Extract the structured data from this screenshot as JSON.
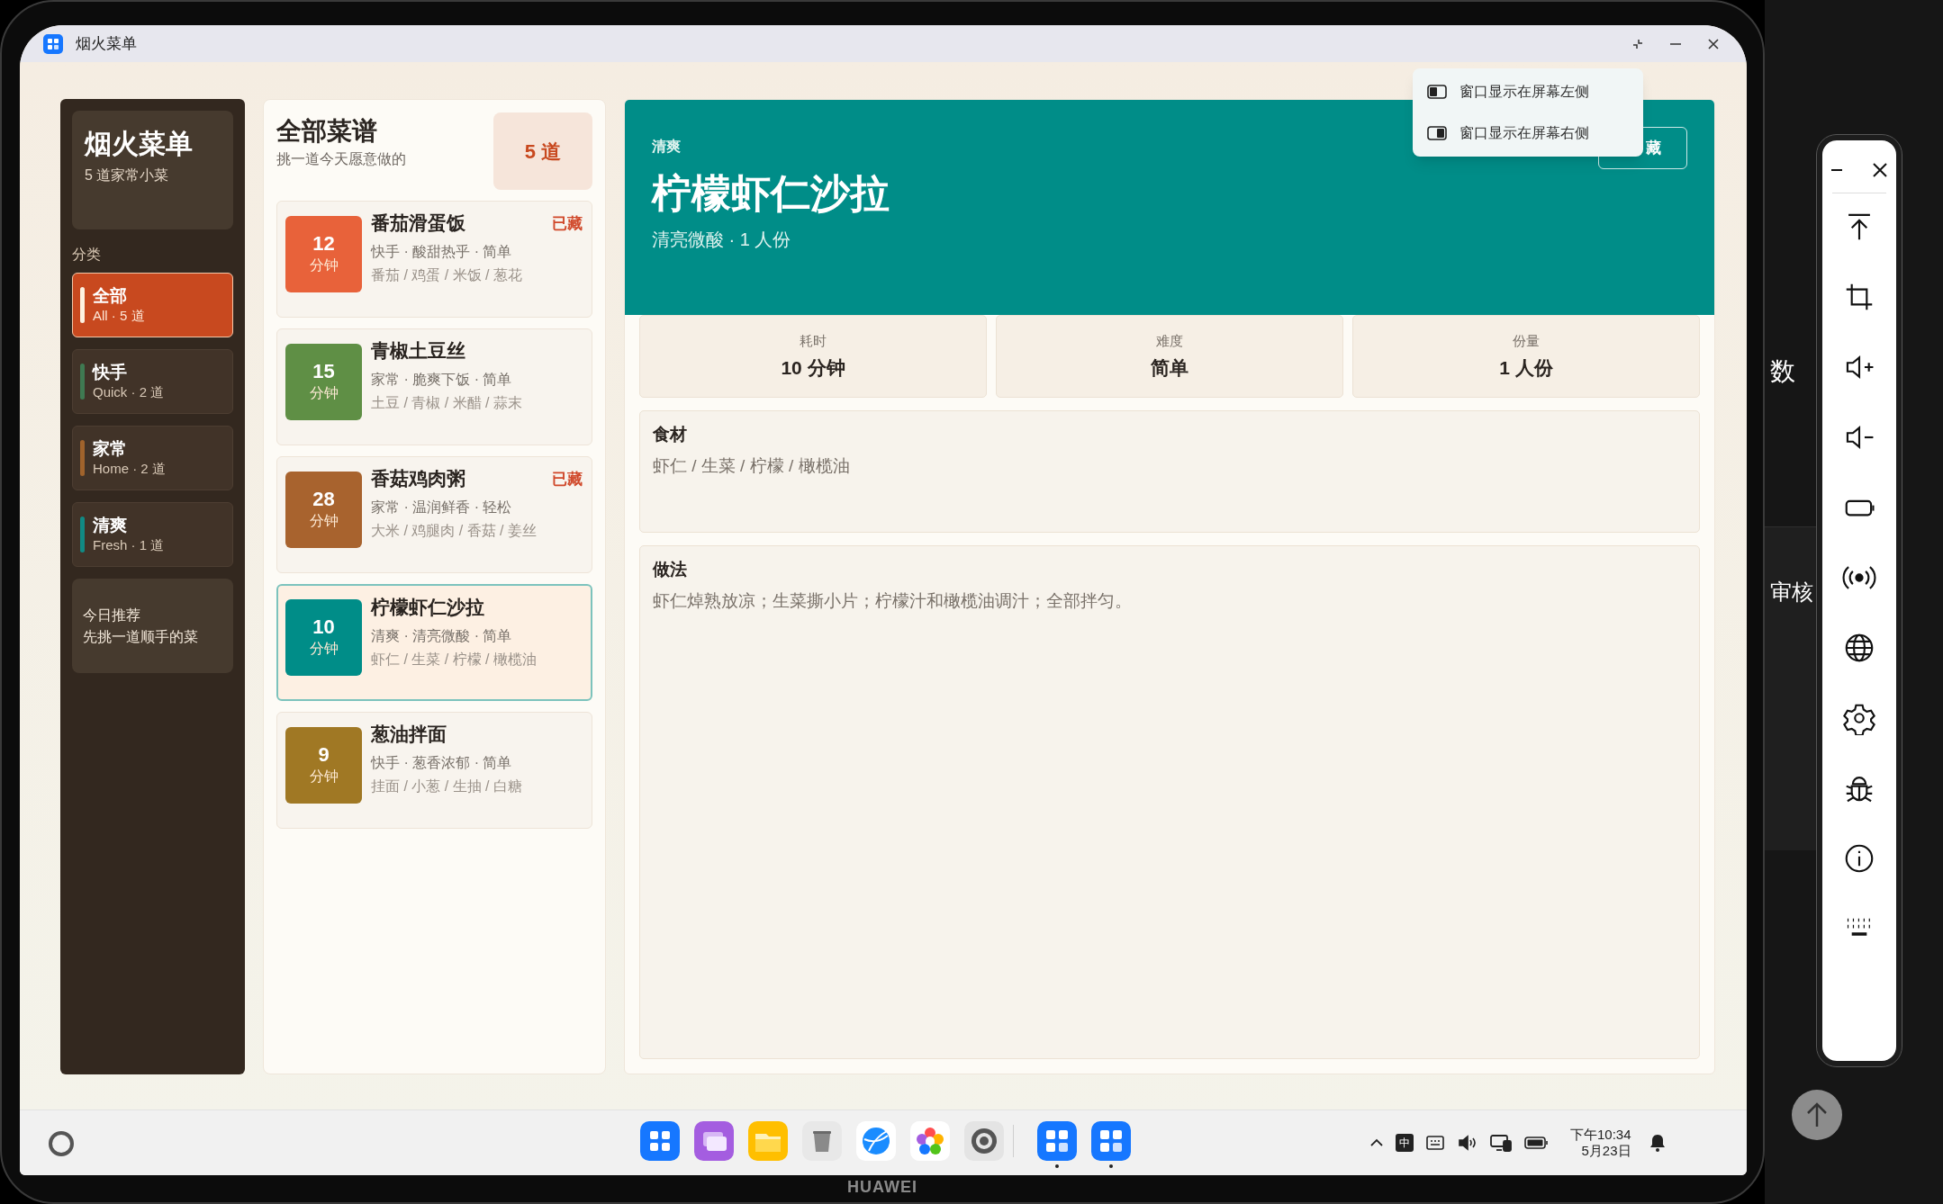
{
  "window": {
    "title": "烟火菜单"
  },
  "sidebar": {
    "title": "烟火菜单",
    "subtitle": "5 道家常小菜",
    "section_label": "分类",
    "categories": [
      {
        "name": "全部",
        "caption": "All · 5 道",
        "color": "#fdf1e0",
        "selected": true
      },
      {
        "name": "快手",
        "caption": "Quick · 2 道",
        "color": "#3f7a52",
        "selected": false
      },
      {
        "name": "家常",
        "caption": "Home · 2 道",
        "color": "#a0632c",
        "selected": false
      },
      {
        "name": "清爽",
        "caption": "Fresh · 1 道",
        "color": "#118a84",
        "selected": false
      }
    ],
    "promo": {
      "title": "今日推荐",
      "text": "先挑一道顺手的菜"
    }
  },
  "recipe_list": {
    "title": "全部菜谱",
    "subtitle": "挑一道今天愿意做的",
    "count": "5 道",
    "items": [
      {
        "minutes": "12",
        "unit": "分钟",
        "color": "#e8623a",
        "name": "番茄滑蛋饭",
        "meta": "快手 · 酸甜热乎 · 简单",
        "ingredients": "番茄 / 鸡蛋 / 米饭 / 葱花",
        "badge": "已藏",
        "selected": false
      },
      {
        "minutes": "15",
        "unit": "分钟",
        "color": "#5f8f45",
        "name": "青椒土豆丝",
        "meta": "家常 · 脆爽下饭 · 简单",
        "ingredients": "土豆 / 青椒 / 米醋 / 蒜末",
        "selected": false
      },
      {
        "minutes": "28",
        "unit": "分钟",
        "color": "#a8632e",
        "name": "香菇鸡肉粥",
        "meta": "家常 · 温润鲜香 · 轻松",
        "ingredients": "大米 / 鸡腿肉 / 香菇 / 姜丝",
        "badge": "已藏",
        "selected": false
      },
      {
        "minutes": "10",
        "unit": "分钟",
        "color": "#008d88",
        "name": "柠檬虾仁沙拉",
        "meta": "清爽 · 清亮微酸 · 简单",
        "ingredients": "虾仁 / 生菜 / 柠檬 / 橄榄油",
        "selected": true
      },
      {
        "minutes": "9",
        "unit": "分钟",
        "color": "#a07824",
        "name": "葱油拌面",
        "meta": "快手 · 葱香浓郁 · 简单",
        "ingredients": "挂面 / 小葱 / 生抽 / 白糖",
        "selected": false
      }
    ]
  },
  "detail": {
    "tag": "清爽",
    "title": "柠檬虾仁沙拉",
    "subtitle": "清亮微酸 · 1 人份",
    "button": "藏",
    "stats": [
      {
        "label": "耗时",
        "value": "10 分钟"
      },
      {
        "label": "难度",
        "value": "简单"
      },
      {
        "label": "份量",
        "value": "1 人份"
      }
    ],
    "sections": [
      {
        "title": "食材",
        "text": "虾仁 / 生菜 / 柠檬 / 橄榄油"
      },
      {
        "title": "做法",
        "text": "虾仁焯熟放凉；生菜撕小片；柠檬汁和橄榄油调汁；全部拌匀。"
      }
    ]
  },
  "window_menu": {
    "items": [
      {
        "label": "窗口显示在屏幕左侧",
        "kind": "left"
      },
      {
        "label": "窗口显示在屏幕右侧",
        "kind": "right"
      }
    ]
  },
  "taskbar": {
    "dock": [
      {
        "kind": "launcher",
        "running": false
      },
      {
        "kind": "multiwindow",
        "running": false
      },
      {
        "kind": "files",
        "running": false
      },
      {
        "kind": "trash",
        "running": false
      },
      {
        "kind": "browser",
        "running": false
      },
      {
        "kind": "gallery",
        "running": false
      },
      {
        "kind": "settings",
        "running": false
      },
      {
        "kind": "app",
        "running": true
      },
      {
        "kind": "app",
        "running": true
      }
    ],
    "input_method": "中",
    "time": "下午10:34",
    "date": "5月23日"
  },
  "background_window": {
    "texts": [
      "数",
      "审核"
    ]
  },
  "tool_panel": {
    "tools": [
      {
        "kind": "pin-top"
      },
      {
        "kind": "crop"
      },
      {
        "kind": "volume-up"
      },
      {
        "kind": "volume-down"
      },
      {
        "kind": "battery"
      },
      {
        "kind": "signal"
      },
      {
        "kind": "globe"
      },
      {
        "kind": "settings"
      },
      {
        "kind": "bug"
      },
      {
        "kind": "info"
      },
      {
        "kind": "keyboard"
      }
    ]
  },
  "device": {
    "brand": "HUAWEI"
  }
}
